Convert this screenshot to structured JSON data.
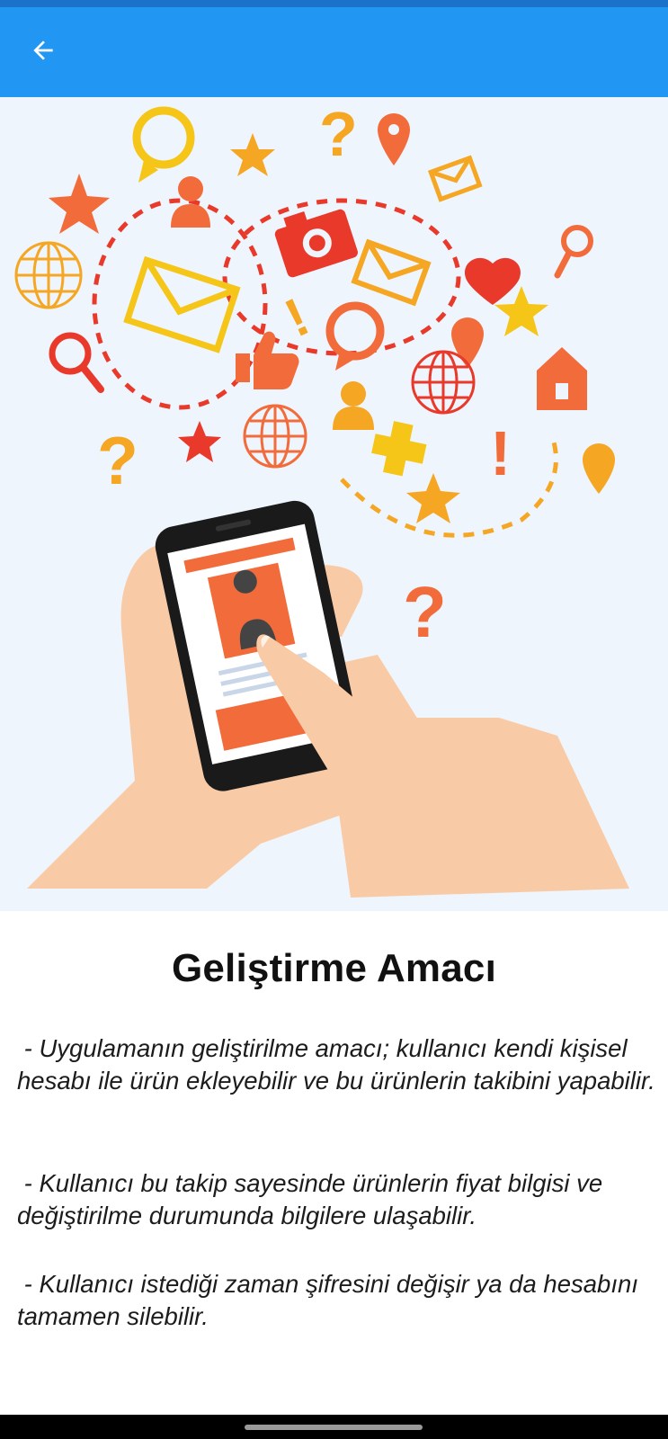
{
  "app_bar": {
    "background": "#2196F3",
    "back_icon": "arrow-left-icon"
  },
  "hero_image": {
    "description_icon": "hand-holding-phone-social-icons-illustration",
    "background": "#EEF5FC"
  },
  "content": {
    "title": "Geliştirme Amacı",
    "paragraphs": [
      " - Uygulamanın geliştirilme amacı; kullanıcı kendi kişisel hesabı ile ürün ekleyebilir ve bu ürünlerin takibini yapabilir.",
      " - Kullanıcı bu takip sayesinde ürünlerin fiyat bilgisi ve değiştirilme durumunda bilgilere ulaşabilir.",
      " - Kullanıcı istediği zaman şifresini değişir ya da hesabını tamamen silebilir."
    ]
  },
  "colors": {
    "accent": "#2196F3",
    "orange": "#F26B3A",
    "yellow": "#F5C518",
    "red": "#E8392A"
  }
}
